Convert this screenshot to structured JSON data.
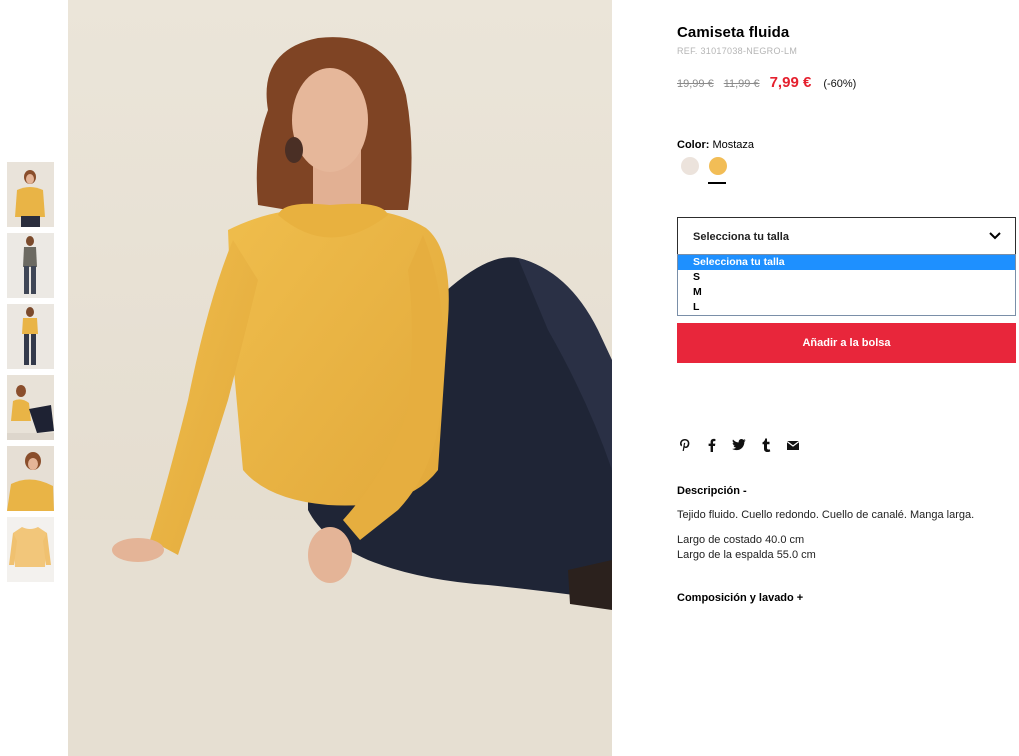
{
  "thumbnails": [
    {
      "label": "thumb-1"
    },
    {
      "label": "thumb-2"
    },
    {
      "label": "thumb-3"
    },
    {
      "label": "thumb-4"
    },
    {
      "label": "thumb-5"
    },
    {
      "label": "thumb-6"
    }
  ],
  "product": {
    "title": "Camiseta fluida",
    "ref": "REF. 31017038-NEGRO-LM",
    "price_original_1": "19,99 €",
    "price_original_2": "11,99 €",
    "price_current": "7,99 €",
    "discount": "(-60%)"
  },
  "color": {
    "label": "Color:",
    "value": "Mostaza",
    "swatches": [
      {
        "name": "cream",
        "hex": "#ece3dc"
      },
      {
        "name": "mustard",
        "hex": "#f2bd56"
      }
    ]
  },
  "size": {
    "select_label": "Selecciona tu talla",
    "options": [
      "Selecciona tu talla",
      "S",
      "M",
      "L"
    ]
  },
  "add_button": "Añadir a la bolsa",
  "share_icons": [
    "pinterest-icon",
    "facebook-icon",
    "twitter-icon",
    "tumblr-icon",
    "email-icon"
  ],
  "description": {
    "heading": "Descripción  -",
    "line1": "Tejido fluido. Cuello redondo. Cuello de canalé. Manga larga.",
    "line2": "Largo de costado 40.0 cm",
    "line3": "Largo de la espalda 55.0 cm"
  },
  "composition_heading": "Composición y lavado  +",
  "colors": {
    "accent_red": "#e8263b",
    "price_red": "#e5202e",
    "dropdown_highlight": "#1e90ff"
  }
}
